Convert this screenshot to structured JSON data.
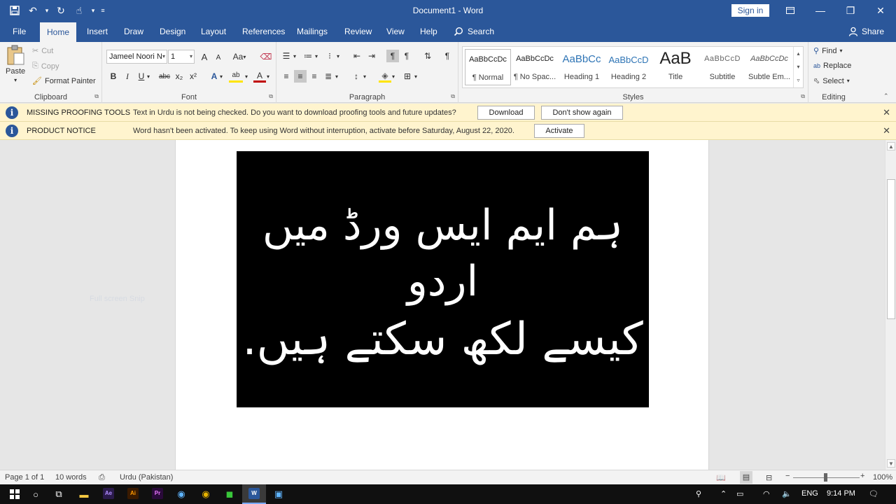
{
  "colors": {
    "ribbon_blue": "#2b579a",
    "message_bg": "#fff4ce",
    "doc_image_bg": "#000000",
    "taskbar": "#101010"
  },
  "titlebar": {
    "title": "Document1  -  Word",
    "sign_in": "Sign in",
    "qat_icons": [
      "save-icon",
      "undo-icon",
      "redo-icon",
      "touch-mode-icon",
      "customize-icon"
    ]
  },
  "tabs": [
    "File",
    "Home",
    "Insert",
    "Draw",
    "Design",
    "Layout",
    "References",
    "Mailings",
    "Review",
    "View",
    "Help"
  ],
  "active_tab": "Home",
  "tell_me": "Search",
  "share": "Share",
  "clipboard": {
    "paste": "Paste",
    "cut": "Cut",
    "copy": "Copy",
    "format_painter": "Format Painter",
    "label": "Clipboard"
  },
  "font": {
    "name": "Jameel Noori N",
    "size": "1",
    "label": "Font",
    "bold": "B",
    "italic": "I",
    "underline": "U",
    "strike": "abc",
    "sub": "x₂",
    "sup": "x²",
    "grow": "A",
    "shrink": "A",
    "case": "Aa",
    "effects": "A",
    "highlight": "ab",
    "color": "A"
  },
  "paragraph": {
    "label": "Paragraph"
  },
  "styles": {
    "label": "Styles",
    "items": [
      {
        "preview": "AaBbCcDc",
        "name": "¶ Normal"
      },
      {
        "preview": "AaBbCcDc",
        "name": "¶ No Spac..."
      },
      {
        "preview": "AaBbCc",
        "name": "Heading 1"
      },
      {
        "preview": "AaBbCcD",
        "name": "Heading 2"
      },
      {
        "preview": "AaB",
        "name": "Title"
      },
      {
        "preview": "AaBbCcD",
        "name": "Subtitle"
      },
      {
        "preview": "AaBbCcDc",
        "name": "Subtle Em..."
      }
    ]
  },
  "editing": {
    "label": "Editing",
    "find": "Find",
    "replace": "Replace",
    "select": "Select"
  },
  "messages": [
    {
      "title": "MISSING PROOFING TOOLS",
      "text": "Text in Urdu is not being checked. Do you want to download proofing tools and future updates?",
      "buttons": [
        "Download",
        "Don't show again"
      ]
    },
    {
      "title": "PRODUCT NOTICE",
      "text": "Word hasn't been activated. To keep using Word without interruption, activate before Saturday, August 22, 2020.",
      "buttons": [
        "Activate"
      ]
    }
  ],
  "document": {
    "faint_text": "Full screen Snip",
    "image_text_line1": "ہم ایم ایس ورڈ میں اردو",
    "image_text_line2": "کیسے لکھ سکتے ہیں."
  },
  "status": {
    "page": "Page 1 of 1",
    "words": "10 words",
    "language": "Urdu (Pakistan)",
    "zoom": "100%",
    "zoom_minus": "−",
    "zoom_plus": "+"
  },
  "taskbar": {
    "apps": [
      {
        "label": "Ae",
        "color": "#2a1a4a",
        "fg": "#b08cff"
      },
      {
        "label": "Ai",
        "color": "#3a1a00",
        "fg": "#ff9a00"
      },
      {
        "label": "Pr",
        "color": "#2a0a3a",
        "fg": "#ea77ff"
      },
      {
        "label": "W",
        "color": "#2b579a",
        "fg": "#ffffff"
      }
    ],
    "language": "ENG",
    "time": "9:14 PM"
  }
}
